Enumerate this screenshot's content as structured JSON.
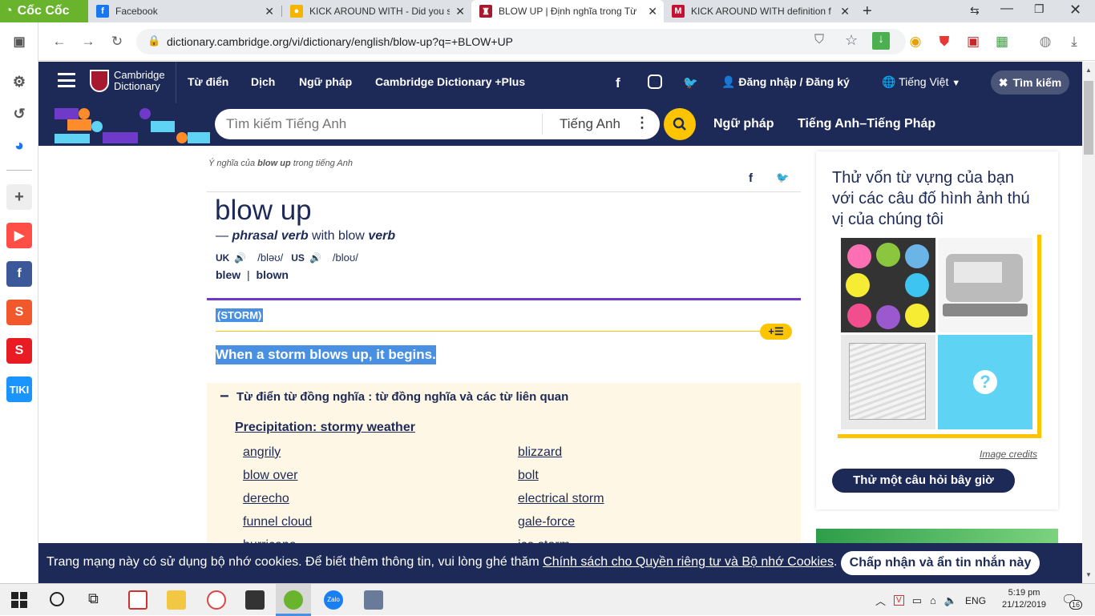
{
  "tabs": [
    {
      "title": "Cốc Cốc",
      "brand": true
    },
    {
      "title": "Facebook",
      "color": "#1877f2",
      "glyph": "f"
    },
    {
      "title": "KICK AROUND WITH - Did you spe",
      "color": "#f4b400",
      "glyph": "●"
    },
    {
      "title": "BLOW UP | Định nghĩa trong Từ điể",
      "color": "#a6192e",
      "glyph": "♜",
      "active": true
    },
    {
      "title": "KICK AROUND WITH definition fro",
      "color": "#c41230",
      "glyph": "M"
    }
  ],
  "browser": {
    "url": "dictionary.cambridge.org/vi/dictionary/english/blow-up?q=+BLOW+UP"
  },
  "site": {
    "logo_line1": "Cambridge",
    "logo_line2": "Dictionary",
    "nav": [
      "Từ điển",
      "Dịch",
      "Ngữ pháp",
      "Cambridge Dictionary +Plus"
    ],
    "login": "Đăng nhập / Đăng ký",
    "language": "Tiếng Việt",
    "search_btn": "Tìm kiếm",
    "search_placeholder": "Tìm kiếm Tiếng Anh",
    "search_lang": "Tiếng Anh",
    "sub_nav": [
      "Ngữ pháp",
      "Tiếng Anh–Tiếng Pháp"
    ]
  },
  "entry": {
    "crumb_prefix": "Ý nghĩa của ",
    "crumb_word": "blow up",
    "crumb_suffix": " trong tiếng Anh",
    "headword": "blow up",
    "dash": "— ",
    "pos": "phrasal verb",
    "with_text": " with blow ",
    "with_pos": "verb",
    "uk": "UK",
    "uk_ipa": "/bləʊ/",
    "us": "US",
    "us_ipa": "/bloʊ/",
    "form1": "blew",
    "sep": "|",
    "form2": "blown",
    "guideword": "(STORM)",
    "definition": "When a storm blows up, it begins.",
    "thes_title": "Từ điển từ đồng nghĩa : từ đồng nghĩa và các từ liên quan",
    "thes_category": "Precipitation: stormy weather",
    "thes_col1": [
      "angrily",
      "blow over",
      "derecho",
      "funnel cloud",
      "hurricane"
    ],
    "thes_col2": [
      "blizzard",
      "bolt",
      "electrical storm",
      "gale-force",
      "ice storm"
    ]
  },
  "sidebar": {
    "quiz_text": "Thử vốn từ vựng của bạn với các câu đố hình ảnh thú vị của chúng tôi",
    "image_credits": "Image credits",
    "quiz_button": "Thử một câu hỏi bây giờ"
  },
  "cookie": {
    "text": "Trang mạng này có sử dụng bộ nhớ cookies. Để biết thêm thông tin, vui lòng ghé thăm ",
    "link": "Chính sách cho Quyền riêng tư và Bộ nhớ Cookies",
    "end": ".",
    "button": "Chấp nhận và ẩn tin nhắn này"
  },
  "taskbar": {
    "lang": "ENG",
    "time": "5:19 pm",
    "date": "21/12/2019",
    "notif_count": "16"
  },
  "colors": {
    "brand_navy": "#1d2a57",
    "accent_yellow": "#fec400",
    "highlight_blue": "#4a90e2",
    "thesaurus_bg": "#fef7e6"
  }
}
